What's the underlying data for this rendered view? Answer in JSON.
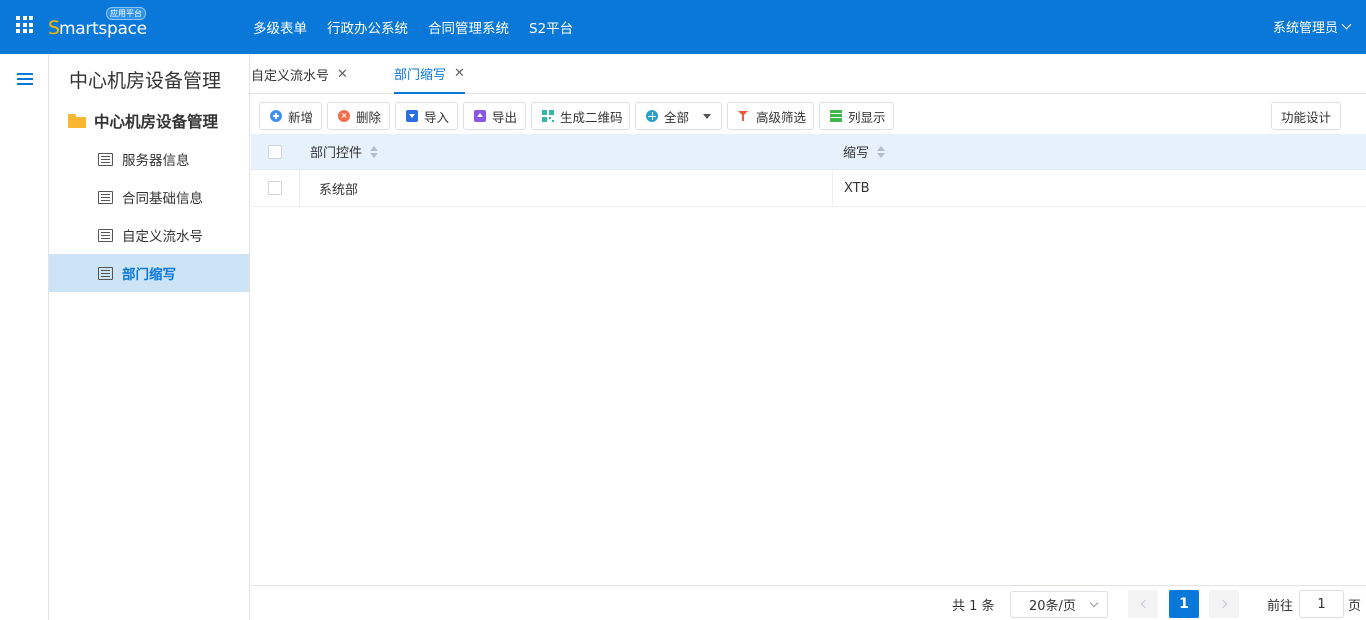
{
  "header": {
    "logo_first_letter": "S",
    "logo_rest": "martspace",
    "logo_badge": "应用平台",
    "nav": [
      "多级表单",
      "行政办公系统",
      "合同管理系统",
      "S2平台"
    ],
    "user": "系统管理员"
  },
  "sidebar": {
    "title": "中心机房设备管理",
    "folder": "中心机房设备管理",
    "items": [
      "服务器信息",
      "合同基础信息",
      "自定义流水号",
      "部门缩写"
    ],
    "active_index": 3
  },
  "tabs": [
    {
      "label": "自定义流水号",
      "active": false
    },
    {
      "label": "部门缩写",
      "active": true
    }
  ],
  "toolbar": {
    "add": "新增",
    "delete": "删除",
    "import": "导入",
    "export": "导出",
    "qrcode": "生成二维码",
    "scope": "全部",
    "advanced_filter": "高级筛选",
    "columns": "列显示",
    "design": "功能设计"
  },
  "table": {
    "columns": [
      "部门控件",
      "缩写"
    ],
    "rows": [
      [
        "系统部",
        "XTB"
      ]
    ]
  },
  "pagination": {
    "total": "共 1 条",
    "page_size": "20条/页",
    "current_page": "1",
    "goto_prefix": "前往",
    "goto_value": "1",
    "goto_suffix": "页"
  },
  "colors": {
    "primary": "#0a78d8",
    "header_bg": "#0a78d8",
    "logo_accent": "#f5b800",
    "active_item_bg": "#cde4f7",
    "table_header_bg": "#e7f1fb"
  }
}
